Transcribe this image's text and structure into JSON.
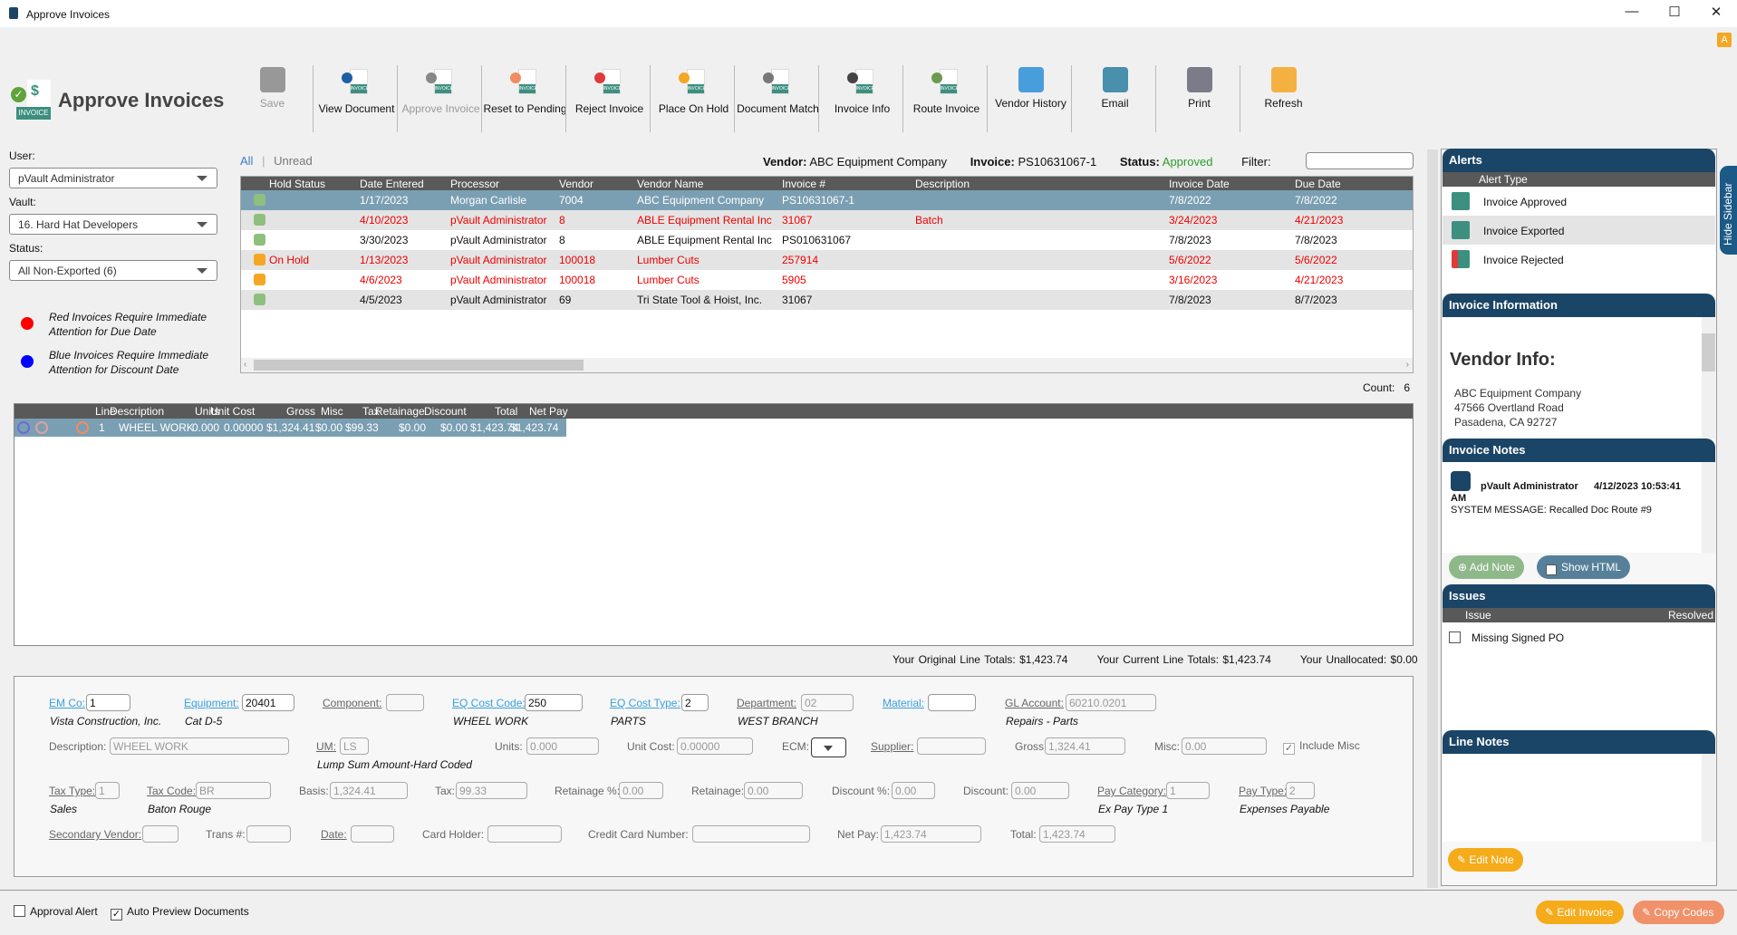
{
  "window": {
    "title": "Approve Invoices",
    "controls": [
      "—",
      "☐",
      "✕"
    ]
  },
  "header": {
    "title": "Approve Invoices"
  },
  "toolbar": [
    {
      "label": "Save",
      "icon": "save-icon",
      "enabled": false,
      "color": "#888"
    },
    {
      "label": "View Document",
      "icon": "view-document-icon",
      "enabled": true,
      "color": "#1d5fa3"
    },
    {
      "label": "Approve Invoice",
      "icon": "approve-invoice-icon",
      "enabled": false,
      "color": "#888"
    },
    {
      "label": "Reset to Pending",
      "icon": "reset-pending-icon",
      "enabled": true,
      "color": "#f08c60"
    },
    {
      "label": "Reject Invoice",
      "icon": "reject-invoice-icon",
      "enabled": true,
      "color": "#e03a3a"
    },
    {
      "label": "Place On Hold",
      "icon": "hold-invoice-icon",
      "enabled": true,
      "color": "#f5a623"
    },
    {
      "label": "Document Match",
      "icon": "document-match-icon",
      "enabled": true,
      "color": "#777"
    },
    {
      "label": "Invoice Info",
      "icon": "invoice-info-icon",
      "enabled": true,
      "color": "#444"
    },
    {
      "label": "Route Invoice",
      "icon": "route-invoice-icon",
      "enabled": true,
      "color": "#6b9a4f"
    },
    {
      "label": "Vendor History",
      "icon": "vendor-history-icon",
      "enabled": true,
      "color": "#2a8fd6"
    },
    {
      "label": "Email",
      "icon": "email-icon",
      "enabled": true,
      "color": "#2a7fa0"
    },
    {
      "label": "Print",
      "icon": "print-icon",
      "enabled": true,
      "color": "#667"
    },
    {
      "label": "Refresh",
      "icon": "refresh-icon",
      "enabled": true,
      "color": "#f5a623"
    }
  ],
  "left": {
    "user_label": "User:",
    "user": "pVault Administrator",
    "vault_label": "Vault:",
    "vault": "16. Hard Hat Developers",
    "status_label": "Status:",
    "status": "All Non-Exported (6)",
    "legend": [
      {
        "color": "#ff0000",
        "text1": "Red Invoices Require Immediate",
        "text2": "Attention for Due Date"
      },
      {
        "color": "#0000ff",
        "text1": "Blue Invoices Require Immediate",
        "text2": "Attention for Discount Date"
      }
    ]
  },
  "filterbar": {
    "all": "All",
    "sep": "|",
    "unread": "Unread",
    "vendor_label": "Vendor:",
    "vendor": "ABC Equipment Company",
    "invoice_label": "Invoice:",
    "invoice": "PS10631067-1",
    "status_label": "Status:",
    "status": "Approved",
    "filter_label": "Filter:",
    "filter_value": ""
  },
  "grid": {
    "columns": [
      "Hold Status",
      "Date Entered",
      "Processor",
      "Vendor",
      "Vendor Name",
      "Invoice #",
      "Description",
      "Invoice Date",
      "Due Date"
    ],
    "rows": [
      {
        "style": "selected",
        "icon": "green",
        "cells": [
          "",
          "1/17/2023",
          "Morgan Carlisle",
          "7004",
          "ABC Equipment Company",
          "PS10631067-1",
          "",
          "7/8/2022",
          "7/8/2022"
        ]
      },
      {
        "style": "red alt",
        "icon": "green",
        "cells": [
          "",
          "4/10/2023",
          "pVault Administrator",
          "8",
          "ABLE Equipment Rental Inc",
          "31067",
          "Batch",
          "3/24/2023",
          "4/21/2023"
        ]
      },
      {
        "style": "normal",
        "icon": "green",
        "cells": [
          "",
          "3/30/2023",
          "pVault Administrator",
          "8",
          "ABLE Equipment Rental Inc",
          "PS010631067",
          "",
          "7/8/2023",
          "7/8/2023"
        ]
      },
      {
        "style": "red alt",
        "icon": "orange",
        "cells": [
          "On Hold",
          "1/13/2023",
          "pVault Administrator",
          "100018",
          "Lumber Cuts",
          "257914",
          "",
          "5/6/2022",
          "5/6/2022"
        ]
      },
      {
        "style": "red",
        "icon": "orange",
        "cells": [
          "",
          "4/6/2023",
          "pVault Administrator",
          "100018",
          "Lumber Cuts",
          "5905",
          "",
          "3/16/2023",
          "4/21/2023"
        ]
      },
      {
        "style": "alt",
        "icon": "green",
        "cells": [
          "",
          "4/5/2023",
          "pVault Administrator",
          "69",
          "Tri State Tool & Hoist, Inc.",
          "31067",
          "",
          "7/8/2023",
          "8/7/2023"
        ]
      }
    ],
    "count_label": "Count:",
    "count": "6"
  },
  "lines": {
    "columns": [
      "Line",
      "Description",
      "Units",
      "Unit Cost",
      "Gross",
      "Misc",
      "Tax",
      "Retainage",
      "Discount",
      "Total",
      "Net Pay"
    ],
    "rows": [
      [
        "1",
        "WHEEL WORK",
        "0.000",
        "0.00000",
        "$1,324.41",
        "$0.00",
        "$99.33",
        "$0.00",
        "$0.00",
        "$1,423.74",
        "$1,423.74"
      ]
    ]
  },
  "totals": {
    "original_label": "Your Original Line Totals:",
    "original": "$1,423.74",
    "current_label": "Your Current Line Totals:",
    "current": "$1,423.74",
    "unallocated_label": "Your Unallocated:",
    "unallocated": "$0.00"
  },
  "form": {
    "em_co": {
      "label": "EM Co:",
      "value": "1",
      "desc": "Vista Construction, Inc."
    },
    "equipment": {
      "label": "Equipment:",
      "value": "20401",
      "desc": "Cat D-5"
    },
    "component": {
      "label": "Component:",
      "value": ""
    },
    "eq_cost_code": {
      "label": "EQ Cost Code:",
      "value": "250",
      "desc": "WHEEL WORK"
    },
    "eq_cost_type": {
      "label": "EQ Cost Type:",
      "value": "2",
      "desc": "PARTS"
    },
    "department": {
      "label": "Department:",
      "value": "02",
      "desc": "WEST BRANCH"
    },
    "material": {
      "label": "Material:",
      "value": ""
    },
    "gl_account": {
      "label": "GL Account:",
      "value": "60210.0201",
      "desc": "Repairs - Parts"
    },
    "description": {
      "label": "Description:",
      "value": "WHEEL WORK"
    },
    "um": {
      "label": "UM:",
      "value": "LS",
      "desc": "Lump Sum Amount-Hard Coded"
    },
    "units": {
      "label": "Units:",
      "value": "0.000"
    },
    "unit_cost": {
      "label": "Unit Cost:",
      "value": "0.00000"
    },
    "ecm": {
      "label": "ECM:",
      "value": ""
    },
    "supplier": {
      "label": "Supplier:",
      "value": ""
    },
    "gross": {
      "label": "Gross:",
      "value": "1,324.41"
    },
    "misc": {
      "label": "Misc:",
      "value": "0.00"
    },
    "include_misc": {
      "label": "Include Misc",
      "checked": true
    },
    "tax_type": {
      "label": "Tax Type:",
      "value": "1",
      "desc": "Sales"
    },
    "tax_code": {
      "label": "Tax Code:",
      "value": "BR",
      "desc": "Baton Rouge"
    },
    "basis": {
      "label": "Basis:",
      "value": "1,324.41"
    },
    "tax": {
      "label": "Tax:",
      "value": "99.33"
    },
    "retainage_pct": {
      "label": "Retainage %:",
      "value": "0.00"
    },
    "retainage": {
      "label": "Retainage:",
      "value": "0.00"
    },
    "discount_pct": {
      "label": "Discount %:",
      "value": "0.00"
    },
    "discount": {
      "label": "Discount:",
      "value": "0.00"
    },
    "pay_category": {
      "label": "Pay Category:",
      "value": "1",
      "desc": "Ex Pay Type 1"
    },
    "pay_type": {
      "label": "Pay Type:",
      "value": "2",
      "desc": "Expenses Payable"
    },
    "secondary_vendor": {
      "label": "Secondary Vendor:",
      "value": ""
    },
    "trans": {
      "label": "Trans #:",
      "value": ""
    },
    "date": {
      "label": "Date:",
      "value": ""
    },
    "card_holder": {
      "label": "Card Holder:",
      "value": ""
    },
    "cc_number": {
      "label": "Credit Card Number:",
      "value": ""
    },
    "net_pay": {
      "label": "Net Pay:",
      "value": "1,423.74"
    },
    "total": {
      "label": "Total:",
      "value": "1,423.74"
    }
  },
  "bottom": {
    "approval_alert": "Approval Alert",
    "approval_alert_checked": false,
    "auto_preview": "Auto Preview Documents",
    "auto_preview_checked": true,
    "edit_invoice": "Edit Invoice",
    "copy_codes": "Copy Codes"
  },
  "sidebar": {
    "hide": "Hide Sidebar",
    "alerts": {
      "title": "Alerts",
      "column": "Alert Type",
      "items": [
        "Invoice Approved",
        "Invoice Exported",
        "Invoice Rejected"
      ]
    },
    "info": {
      "title": "Invoice Information",
      "heading": "Vendor Info:",
      "lines": [
        "ABC Equipment Company",
        "47566 Overtland Road",
        "Pasadena, CA 92727"
      ]
    },
    "notes": {
      "title": "Invoice Notes",
      "author": "pVault Administrator",
      "timestamp": "4/12/2023 10:53:41",
      "ampm": "AM",
      "message": "SYSTEM MESSAGE: Recalled Doc Route #9",
      "add_note": "Add Note",
      "show_html": "Show HTML",
      "show_html_checked": true
    },
    "issues": {
      "title": "Issues",
      "col_issue": "Issue",
      "col_resolved": "Resolved",
      "items": [
        "Missing Signed PO"
      ]
    },
    "line_notes": {
      "title": "Line Notes",
      "edit_note": "Edit Note"
    }
  },
  "colors": {
    "accent": "#1b4566",
    "selected_row": "#7a9fb3",
    "red": "#e00000",
    "approved": "#2a9d2a",
    "orange_button": "#f5ab1a",
    "copy_button": "#f0916a"
  }
}
